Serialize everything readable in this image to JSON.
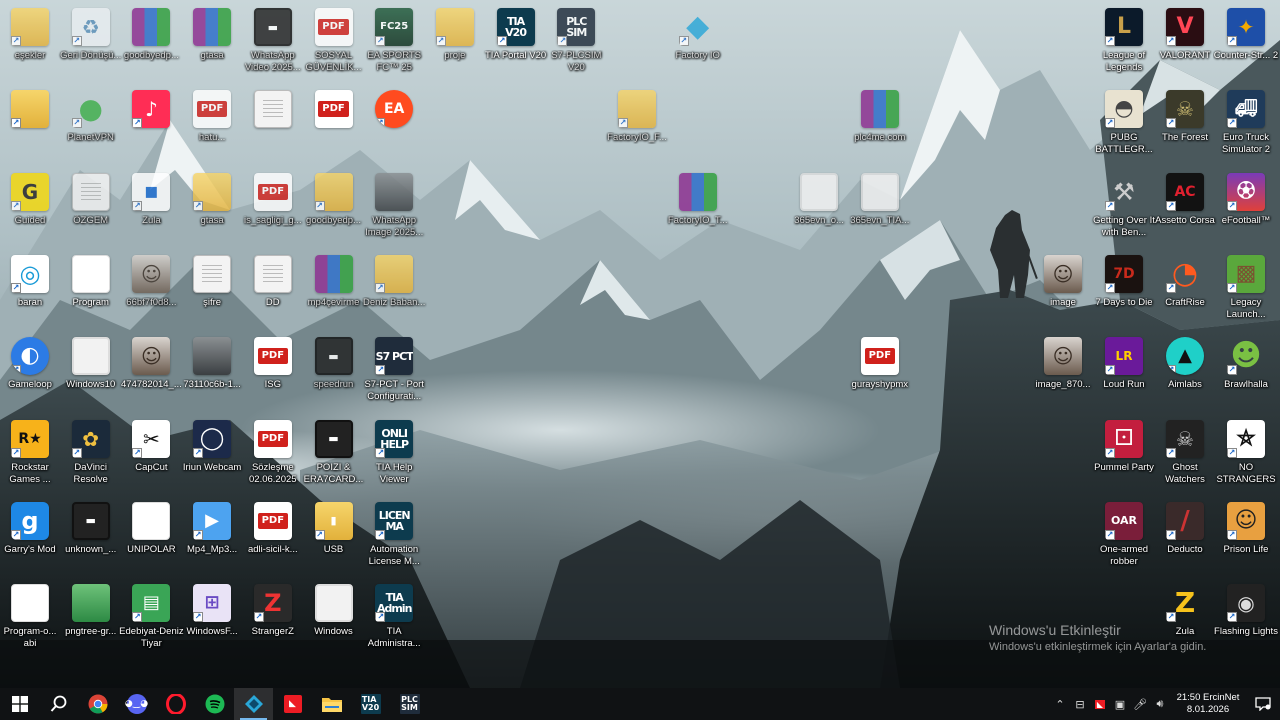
{
  "desktop": {
    "icons": [
      {
        "label": "eşekler",
        "kind": "folder-doc",
        "col": 0,
        "row": 0,
        "dim": true
      },
      {
        "label": "Geri Dönüşü...",
        "kind": "recycle",
        "col": 1,
        "row": 0,
        "dim": true
      },
      {
        "label": "goodbyedp...",
        "kind": "rar",
        "col": 2,
        "row": 0,
        "dim": true
      },
      {
        "label": "gtasa",
        "kind": "rar",
        "col": 3,
        "row": 0,
        "dim": true
      },
      {
        "label": "WhatsApp Video 2025...",
        "kind": "video",
        "col": 4,
        "row": 0,
        "dim": true
      },
      {
        "label": "SOSYAL GÜVENLİK...",
        "kind": "pdf",
        "col": 5,
        "row": 0,
        "dim": true
      },
      {
        "label": "EA SPORTS FC™ 25",
        "kind": "fc25",
        "col": 6,
        "row": 0,
        "dim": true
      },
      {
        "label": "proje",
        "kind": "tia-folder",
        "col": 7,
        "row": 0,
        "dim": true
      },
      {
        "label": "TIA Portal V20",
        "kind": "tia",
        "glyph_text": "TIA V20",
        "col": 8,
        "row": 0
      },
      {
        "label": "S7-PLCSIM V20",
        "kind": "plc",
        "glyph_text": "PLC SIM",
        "col": 9,
        "row": 0,
        "dim": true
      },
      {
        "label": "Factory IO",
        "kind": "factoryio",
        "col": 11,
        "row": 0,
        "dim": true
      },
      {
        "label": "",
        "kind": "folder-doc",
        "col": 0,
        "row": 1
      },
      {
        "label": "PlanetVPN",
        "kind": "planetvpn",
        "col": 1,
        "row": 1,
        "dim": true
      },
      {
        "label": "",
        "kind": "tiktok",
        "col": 2,
        "row": 1
      },
      {
        "label": "hatu...",
        "kind": "pdf",
        "col": 3,
        "row": 1,
        "dim": true
      },
      {
        "label": "",
        "kind": "doc",
        "col": 4,
        "row": 1
      },
      {
        "label": "",
        "kind": "pdf",
        "col": 5,
        "row": 1
      },
      {
        "label": "",
        "kind": "ea",
        "col": 6,
        "row": 1
      },
      {
        "label": "FactoryIO_F...",
        "kind": "folder-doc",
        "col": 10,
        "row": 1,
        "dim": true
      },
      {
        "label": "plc4me.com",
        "kind": "rar",
        "col": 14,
        "row": 1,
        "dim": true
      },
      {
        "label": "Guided",
        "kind": "guided",
        "col": 0,
        "row": 2,
        "dim": true
      },
      {
        "label": "ÖZGEM",
        "kind": "doc",
        "col": 1,
        "row": 2,
        "dim": true
      },
      {
        "label": "Zula",
        "kind": "zula-doc",
        "col": 2,
        "row": 2,
        "dim": true
      },
      {
        "label": "gtasa",
        "kind": "folder",
        "col": 3,
        "row": 2,
        "dim": true
      },
      {
        "label": "is_sagligi_g...",
        "kind": "pdf",
        "col": 4,
        "row": 2,
        "dim": true
      },
      {
        "label": "goodbyedp...",
        "kind": "folder",
        "col": 5,
        "row": 2,
        "dim": true
      },
      {
        "label": "WhatsApp Image 2025...",
        "kind": "img",
        "col": 6,
        "row": 2,
        "dim": true
      },
      {
        "label": "FactoryIO_T...",
        "kind": "rar",
        "col": 11,
        "row": 2,
        "dim": true
      },
      {
        "label": "365evn_o...",
        "kind": "globe",
        "col": 13,
        "row": 2,
        "dim": true
      },
      {
        "label": "365evn_TIA...",
        "kind": "globe",
        "col": 14,
        "row": 2,
        "dim": true
      },
      {
        "label": "baran",
        "kind": "baran",
        "col": 0,
        "row": 3
      },
      {
        "label": "Program",
        "kind": "xls",
        "col": 1,
        "row": 3
      },
      {
        "label": "66bf7f0d8...",
        "kind": "img-face",
        "col": 2,
        "row": 3,
        "dim": true
      },
      {
        "label": "şifre",
        "kind": "doc",
        "col": 3,
        "row": 3
      },
      {
        "label": "DD",
        "kind": "doc",
        "col": 4,
        "row": 3
      },
      {
        "label": "mp4çevirme",
        "kind": "rar",
        "col": 5,
        "row": 3,
        "dim": true
      },
      {
        "label": "Deniz Baban...",
        "kind": "tia-folder",
        "col": 6,
        "row": 3,
        "dim": true
      },
      {
        "label": "Gameloop",
        "kind": "gameloop",
        "col": 0,
        "row": 4
      },
      {
        "label": "Windows10",
        "kind": "globe",
        "col": 1,
        "row": 4
      },
      {
        "label": "474782014_...",
        "kind": "img-face",
        "col": 2,
        "row": 4
      },
      {
        "label": "73110c6b-1...",
        "kind": "img",
        "col": 3,
        "row": 4
      },
      {
        "label": "ISG",
        "kind": "pdf",
        "col": 4,
        "row": 4
      },
      {
        "label": "speedrun",
        "kind": "video",
        "col": 5,
        "row": 4,
        "dim": true
      },
      {
        "label": "S7-PCT - Port Configurati...",
        "kind": "plc",
        "glyph_text": "S7 PCT",
        "col": 6,
        "row": 4
      },
      {
        "label": "gurayshypmx",
        "kind": "pdf",
        "col": 14,
        "row": 4
      },
      {
        "label": "Rockstar Games ...",
        "kind": "rockstar",
        "col": 0,
        "row": 5
      },
      {
        "label": "DaVinci Resolve",
        "kind": "davinci",
        "col": 1,
        "row": 5
      },
      {
        "label": "CapCut",
        "kind": "capcut",
        "col": 2,
        "row": 5
      },
      {
        "label": "Iriun Webcam",
        "kind": "iriun",
        "col": 3,
        "row": 5
      },
      {
        "label": "Sözleşme 02.06.2025",
        "kind": "pdf",
        "col": 4,
        "row": 5
      },
      {
        "label": "POIZI & ERA7CARD...",
        "kind": "video",
        "col": 5,
        "row": 5
      },
      {
        "label": "TIA Help Viewer",
        "kind": "tia",
        "glyph_text": "ONLI HELP",
        "col": 6,
        "row": 5
      },
      {
        "label": "Garry's Mod",
        "kind": "gmod",
        "col": 0,
        "row": 6
      },
      {
        "label": "unknown_...",
        "kind": "video",
        "col": 1,
        "row": 6
      },
      {
        "label": "UNIPOLAR",
        "kind": "ppt",
        "col": 2,
        "row": 6
      },
      {
        "label": "Mp4_Mp3...",
        "kind": "mp4mp3",
        "col": 3,
        "row": 6
      },
      {
        "label": "adli-sicil-k...",
        "kind": "pdf",
        "col": 4,
        "row": 6
      },
      {
        "label": "USB",
        "kind": "usb",
        "col": 5,
        "row": 6
      },
      {
        "label": "Automation License M...",
        "kind": "tia",
        "glyph_text": "LICEN MA",
        "col": 6,
        "row": 6
      },
      {
        "label": "Program-o... abi",
        "kind": "xls",
        "col": 0,
        "row": 7
      },
      {
        "label": "pngtree-gr...",
        "kind": "green-img",
        "col": 1,
        "row": 7
      },
      {
        "label": "Edebiyat-Deniz Tiyar",
        "kind": "edebiyat",
        "col": 2,
        "row": 7
      },
      {
        "label": "WindowsF...",
        "kind": "windowsf",
        "col": 3,
        "row": 7
      },
      {
        "label": "StrangerZ",
        "kind": "strangerz",
        "col": 4,
        "row": 7
      },
      {
        "label": "Windows",
        "kind": "globe",
        "col": 5,
        "row": 7
      },
      {
        "label": "TIA Administra...",
        "kind": "tia",
        "glyph_text": "TIA Admin",
        "col": 6,
        "row": 7
      }
    ],
    "right_icons": [
      {
        "label": "League of Legends",
        "kind": "lol",
        "col": 0,
        "row": 0
      },
      {
        "label": "VALORANT",
        "kind": "valorant",
        "col": 1,
        "row": 0
      },
      {
        "label": "Counter-Str... 2",
        "kind": "cs2",
        "col": 2,
        "row": 0
      },
      {
        "label": "PUBG BATTLEGR...",
        "kind": "pubg",
        "col": 0,
        "row": 1
      },
      {
        "label": "The Forest",
        "kind": "forest",
        "col": 1,
        "row": 1
      },
      {
        "label": "Euro Truck Simulator 2",
        "kind": "ets2",
        "col": 2,
        "row": 1
      },
      {
        "label": "Getting Over It with Ben...",
        "kind": "gettingover",
        "col": 0,
        "row": 2
      },
      {
        "label": "Assetto Corsa",
        "kind": "assetto",
        "col": 1,
        "row": 2
      },
      {
        "label": "eFootball™",
        "kind": "efootball",
        "col": 2,
        "row": 2
      },
      {
        "label": "image",
        "kind": "img-face",
        "col": -1,
        "row": 3
      },
      {
        "label": "7 Days to Die",
        "kind": "7days",
        "col": 0,
        "row": 3
      },
      {
        "label": "CraftRise",
        "kind": "craftrise",
        "col": 1,
        "row": 3
      },
      {
        "label": "Legacy Launch...",
        "kind": "legacy",
        "col": 2,
        "row": 3
      },
      {
        "label": "image_870...",
        "kind": "img-face",
        "col": -1,
        "row": 4
      },
      {
        "label": "Loud Run",
        "kind": "loudrun",
        "col": 0,
        "row": 4
      },
      {
        "label": "Aimlabs",
        "kind": "aimlabs",
        "col": 1,
        "row": 4
      },
      {
        "label": "Brawlhalla",
        "kind": "brawlhalla",
        "col": 2,
        "row": 4
      },
      {
        "label": "Pummel Party",
        "kind": "pummel",
        "col": 0,
        "row": 5
      },
      {
        "label": "Ghost Watchers",
        "kind": "ghost",
        "col": 1,
        "row": 5
      },
      {
        "label": "NO STRANGERS",
        "kind": "nostrangers",
        "col": 2,
        "row": 5
      },
      {
        "label": "One-armed robber",
        "kind": "onearmed",
        "col": 0,
        "row": 6
      },
      {
        "label": "Deducto",
        "kind": "deducto",
        "col": 1,
        "row": 6
      },
      {
        "label": "Prison Life",
        "kind": "prisonlife",
        "col": 2,
        "row": 6
      },
      {
        "label": "Zula",
        "kind": "zula",
        "col": 1,
        "row": 7
      },
      {
        "label": "Flashing Lights",
        "kind": "flashing",
        "col": 2,
        "row": 7
      }
    ]
  },
  "watermark": {
    "title": "Windows'u Etkinleştir",
    "subtitle": "Windows'u etkinleştirmek için Ayarlar'a gidin."
  },
  "taskbar": {
    "apps": [
      {
        "name": "start-button",
        "icon": "windows-logo-icon"
      },
      {
        "name": "search-button",
        "icon": "search-icon"
      },
      {
        "name": "chrome",
        "icon": "chrome-icon"
      },
      {
        "name": "discord",
        "icon": "discord-icon"
      },
      {
        "name": "opera",
        "icon": "opera-icon"
      },
      {
        "name": "spotify",
        "icon": "spotify-icon"
      },
      {
        "name": "factory-io",
        "icon": "factoryio-icon",
        "active": true
      },
      {
        "name": "amd",
        "icon": "amd-icon"
      },
      {
        "name": "file-explorer",
        "icon": "folder-icon"
      },
      {
        "name": "tia-portal",
        "icon": "tia-icon",
        "text": "TIA V20"
      },
      {
        "name": "plcsim",
        "icon": "plcsim-icon",
        "text": "PLC SIM"
      }
    ],
    "tray": {
      "time": "21:50 ErcinNet",
      "date": "8.01.2026"
    }
  },
  "colors": {
    "taskbar_bg": "#101214",
    "pdf_red": "#d0211c",
    "accent": "#76b9ed"
  }
}
